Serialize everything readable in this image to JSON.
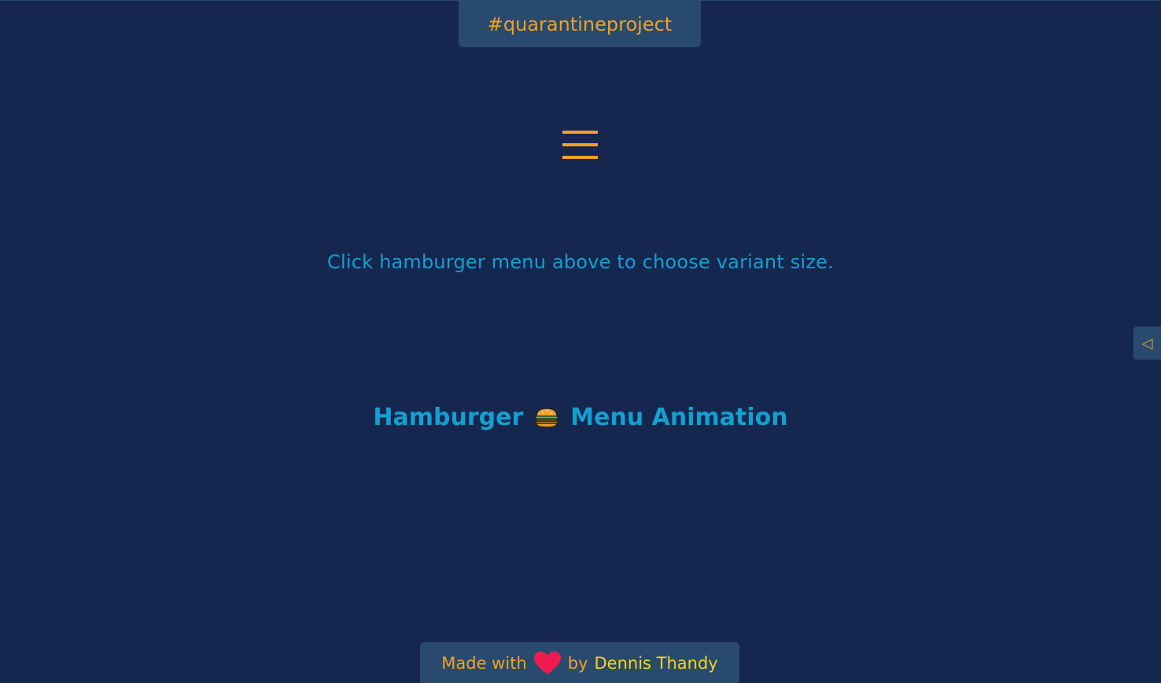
{
  "header": {
    "badge_label": "#quarantineproject"
  },
  "menu": {
    "icon": "hamburger-icon"
  },
  "instruction": {
    "text": "Click hamburger menu above to choose variant size."
  },
  "side_panel": {
    "toggle_glyph": "◁",
    "icon": "triangle-left-icon"
  },
  "title": {
    "part1": "Hamburger",
    "emoji_icon": "burger-icon",
    "part2": "Menu Animation"
  },
  "footer": {
    "made_with": "Made with",
    "heart_icon": "heart-icon",
    "by": "by",
    "author": "Dennis Thandy"
  },
  "colors": {
    "background": "#16274f",
    "panel": "#284a6e",
    "accent_orange": "#f5a020",
    "accent_blue": "#13a0d0",
    "accent_yellow": "#f7d21c",
    "heart": "#ee1c4e"
  }
}
